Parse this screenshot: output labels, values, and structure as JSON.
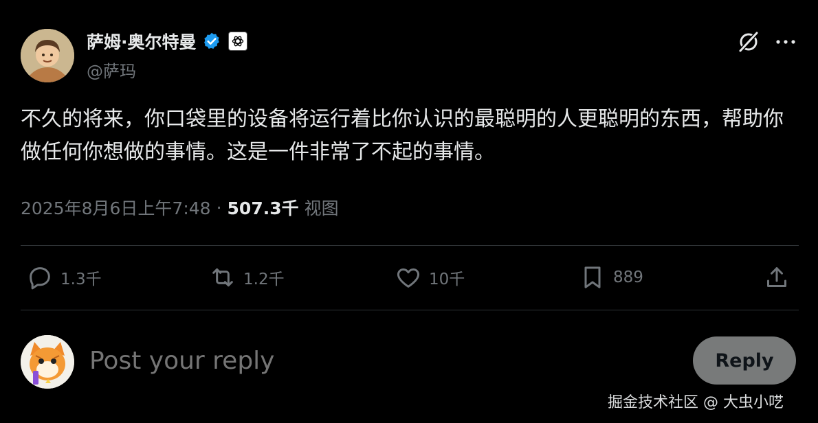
{
  "author": {
    "name": "萨姆·奥尔特曼",
    "handle": "@萨玛",
    "verified_color": "#1d9bf0"
  },
  "tweet": {
    "text": "不久的将来，你口袋里的设备将运行着比你认识的最聪明的人更聪明的东西，帮助你做任何你想做的事情。这是一件非常了不起的事情。",
    "timestamp": "2025年8月6日上午7:48",
    "separator": "·",
    "views_count": "507.3千",
    "views_label": "视图"
  },
  "actions": {
    "replies": "1.3千",
    "reposts": "1.2千",
    "likes": "10千",
    "bookmarks": "889"
  },
  "reply_box": {
    "placeholder": "Post your reply",
    "button_label": "Reply"
  },
  "watermark": "掘金技术社区 @ 大虫小呓"
}
